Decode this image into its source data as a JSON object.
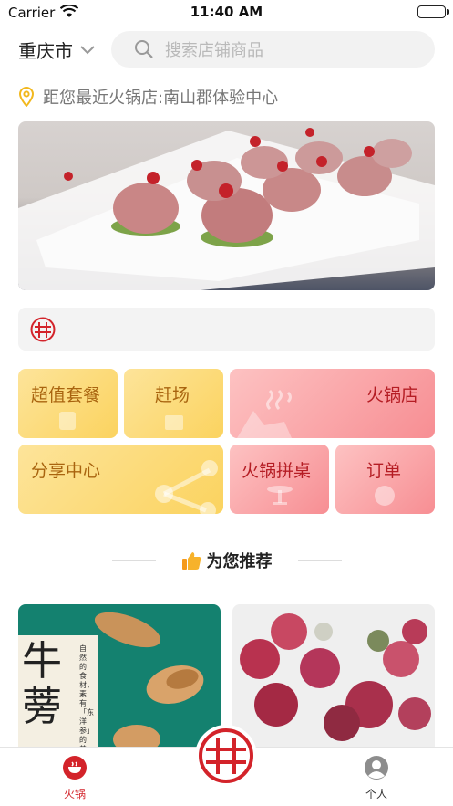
{
  "status_bar": {
    "carrier": "Carrier",
    "time": "11:40 AM"
  },
  "header": {
    "city": "重庆市",
    "search_placeholder": "搜索店铺商品"
  },
  "nearest_store": {
    "text": "距您最近火锅店:南山郡体验中心"
  },
  "grid": {
    "value_combo": "超值套餐",
    "rush": "赶场",
    "hotpot_store": "火锅店",
    "share_center": "分享中心",
    "hotpot_share_table": "火锅拼桌",
    "orders": "订单"
  },
  "recommend": {
    "title": "为您推荐"
  },
  "products": [
    {
      "big_text": "牛蒡",
      "small_text": "自然的食材，素有「东洋参」的美"
    },
    {}
  ],
  "tabbar": {
    "hotpot": "火锅",
    "me": "个人"
  },
  "colors": {
    "brand_red": "#d3232a",
    "tile_yellow": "#fbd35f",
    "tile_pink": "#f78e93",
    "pin_yellow": "#f2b81e"
  }
}
